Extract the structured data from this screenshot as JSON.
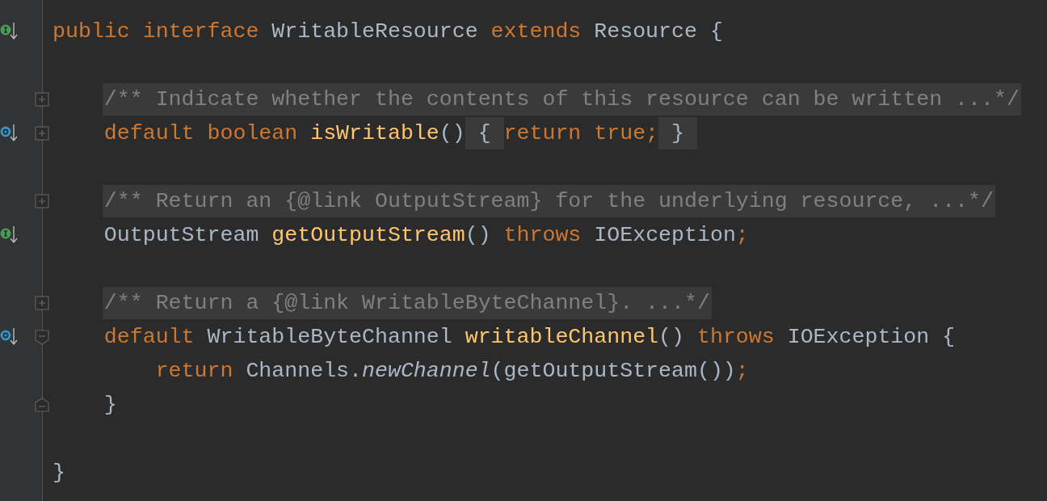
{
  "editor": {
    "lines": [
      {
        "kind": "code",
        "gutter_icon": {
          "kind": "implemented"
        },
        "tokens": [
          {
            "kind": "keyword",
            "text": "public interface"
          },
          {
            "kind": "plain",
            "text": " WritableResource "
          },
          {
            "kind": "keyword",
            "text": "extends"
          },
          {
            "kind": "plain",
            "text": " Resource {"
          }
        ]
      },
      {
        "kind": "blank"
      },
      {
        "kind": "code",
        "fold_marker": {
          "kind": "collapsed"
        },
        "tokens": [
          {
            "kind": "folded-comment",
            "text": "    /** Indicate whether the contents of this resource can be written ...*/"
          }
        ]
      },
      {
        "kind": "code",
        "gutter_icon": {
          "kind": "overriding"
        },
        "fold_marker": {
          "kind": "collapsed"
        },
        "tokens": [
          {
            "kind": "keyword",
            "text": "    default boolean "
          },
          {
            "kind": "method",
            "text": "isWritable"
          },
          {
            "kind": "plain",
            "text": "()"
          },
          {
            "kind": "folded",
            "text": "{"
          },
          {
            "kind": "keyword",
            "text": "return true;"
          },
          {
            "kind": "folded",
            "text": "}"
          }
        ]
      },
      {
        "kind": "blank"
      },
      {
        "kind": "code",
        "fold_marker": {
          "kind": "collapsed"
        },
        "tokens": [
          {
            "kind": "folded-comment",
            "text": "    /** Return an {@link OutputStream} for the underlying resource, ...*/"
          }
        ]
      },
      {
        "kind": "code",
        "gutter_icon": {
          "kind": "implemented"
        },
        "tokens": [
          {
            "kind": "plain",
            "text": "    OutputStream "
          },
          {
            "kind": "method",
            "text": "getOutputStream"
          },
          {
            "kind": "plain",
            "text": "() "
          },
          {
            "kind": "keyword",
            "text": "throws"
          },
          {
            "kind": "plain",
            "text": " IOException"
          },
          {
            "kind": "keyword",
            "text": ";"
          }
        ]
      },
      {
        "kind": "blank"
      },
      {
        "kind": "code",
        "fold_marker": {
          "kind": "collapsed"
        },
        "tokens": [
          {
            "kind": "folded-comment",
            "text": "    /** Return a {@link WritableByteChannel}. ...*/"
          }
        ]
      },
      {
        "kind": "code",
        "gutter_icon": {
          "kind": "overriding"
        },
        "fold_marker": {
          "kind": "start"
        },
        "tokens": [
          {
            "kind": "keyword",
            "text": "    default"
          },
          {
            "kind": "plain",
            "text": " WritableByteChannel "
          },
          {
            "kind": "method",
            "text": "writableChannel"
          },
          {
            "kind": "plain",
            "text": "() "
          },
          {
            "kind": "keyword",
            "text": "throws"
          },
          {
            "kind": "plain",
            "text": " IOException {"
          }
        ]
      },
      {
        "kind": "code",
        "tokens": [
          {
            "kind": "keyword",
            "text": "        return"
          },
          {
            "kind": "plain",
            "text": " Channels."
          },
          {
            "kind": "static-call",
            "text": "newChannel"
          },
          {
            "kind": "plain",
            "text": "(getOutputStream())"
          },
          {
            "kind": "keyword",
            "text": ";"
          }
        ]
      },
      {
        "kind": "code",
        "fold_marker": {
          "kind": "end"
        },
        "tokens": [
          {
            "kind": "plain",
            "text": "    }"
          }
        ]
      },
      {
        "kind": "blank"
      },
      {
        "kind": "code",
        "tokens": [
          {
            "kind": "plain",
            "text": "}"
          }
        ]
      }
    ]
  }
}
